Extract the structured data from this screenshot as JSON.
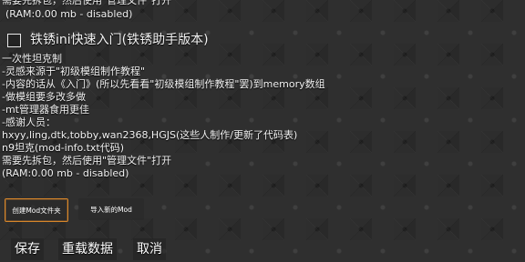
{
  "top": {
    "line1": "需要先拆包，然后使用\"管理文件\"打开",
    "line2": "(RAM:0.00 mb - disabled)"
  },
  "mod": {
    "title": "铁锈ini快速入门(铁锈助手版本)",
    "checked": false,
    "description": [
      "一次性坦克制",
      "-灵感来源于\"初级模组制作教程\"",
      "-内容的话从《入门》(所以先看看\"初级模组制作教程\"罢)到memory数组",
      "-做模组要多改多做",
      "-mt管理器食用更佳",
      "-感谢人员：",
      "hxyy,ling,dtk,tobby,wan2368,HGJS(这些人制作/更新了代码表)",
      "n9坦克(mod-info.txt代码)",
      "需要先拆包，然后使用\"管理文件\"打开",
      "(RAM:0.00 mb - disabled)"
    ]
  },
  "actions": {
    "create_folder": "创建Mod文件夹",
    "import_mod": "导入新的Mod"
  },
  "footer": {
    "save": "保存",
    "reload": "重载数据",
    "cancel": "取消"
  },
  "colors": {
    "accent": "#d7862a",
    "text": "#f2f2f2"
  }
}
